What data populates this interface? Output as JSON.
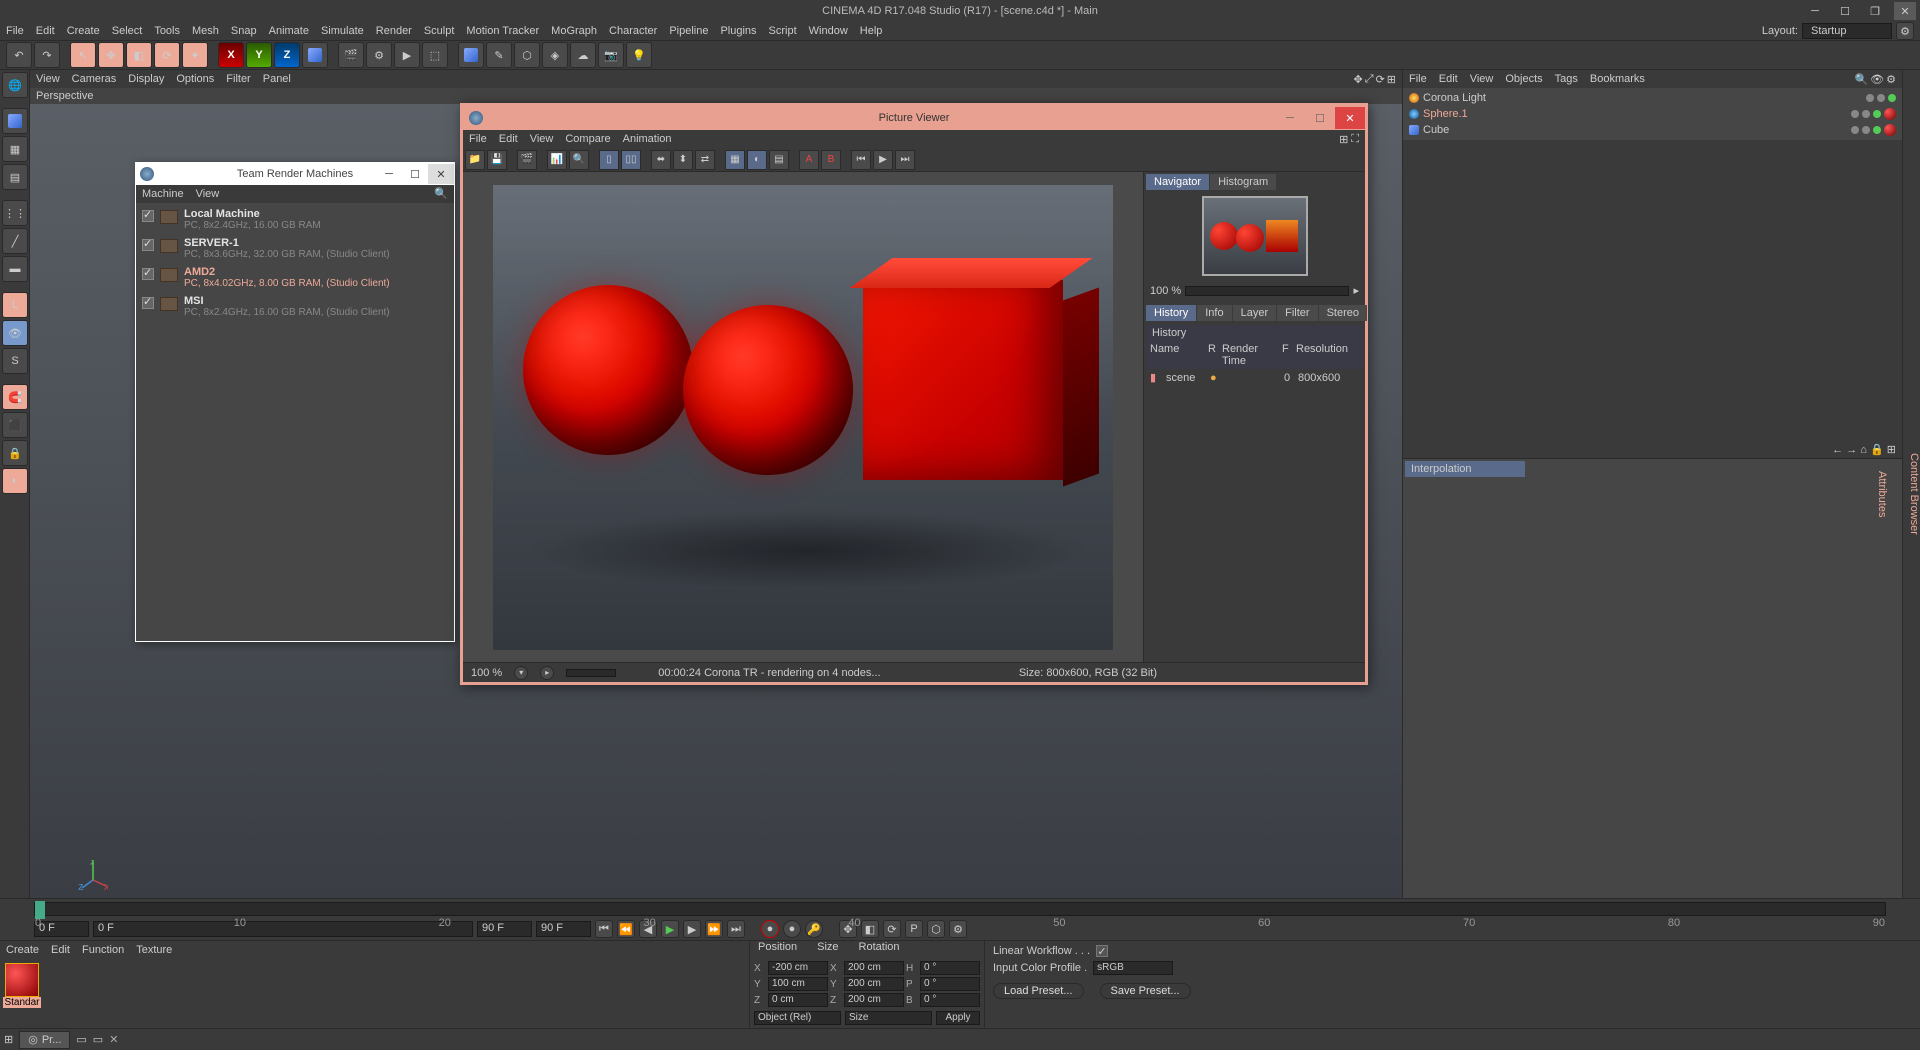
{
  "window": {
    "title": "CINEMA 4D R17.048 Studio (R17) - [scene.c4d *] - Main",
    "layout_label": "Layout:",
    "layout_value": "Startup"
  },
  "menubar": [
    "File",
    "Edit",
    "Create",
    "Select",
    "Tools",
    "Mesh",
    "Snap",
    "Animate",
    "Simulate",
    "Render",
    "Sculpt",
    "Motion Tracker",
    "MoGraph",
    "Character",
    "Pipeline",
    "Plugins",
    "Script",
    "Window",
    "Help"
  ],
  "viewport": {
    "menus": [
      "View",
      "Cameras",
      "Display",
      "Options",
      "Filter",
      "Panel"
    ],
    "label": "Perspective"
  },
  "objects_panel": {
    "menus": [
      "File",
      "Edit",
      "View",
      "Objects",
      "Tags",
      "Bookmarks"
    ],
    "items": [
      {
        "name": "Corona Light",
        "icon": "light",
        "selected": false
      },
      {
        "name": "Sphere.1",
        "icon": "sphere",
        "selected": true
      },
      {
        "name": "Cube",
        "icon": "cube",
        "selected": false
      }
    ]
  },
  "attribute_panel": {
    "tab": "Interpolation"
  },
  "timeline": {
    "start": "0 F",
    "end": "90 F",
    "range_end": "90 F",
    "marks": [
      "0",
      "10",
      "20",
      "30",
      "40",
      "50",
      "60",
      "70",
      "80",
      "90"
    ]
  },
  "material_panel": {
    "menus": [
      "Create",
      "Edit",
      "Function",
      "Texture"
    ],
    "swatch": "Standar"
  },
  "coord_panel": {
    "headers": [
      "Position",
      "Size",
      "Rotation"
    ],
    "rows": [
      {
        "axis": "X",
        "pos": "-200 cm",
        "size_lbl": "X",
        "size": "200 cm",
        "rot_lbl": "H",
        "rot": "0 °"
      },
      {
        "axis": "Y",
        "pos": "100 cm",
        "size_lbl": "Y",
        "size": "200 cm",
        "rot_lbl": "P",
        "rot": "0 °"
      },
      {
        "axis": "Z",
        "pos": "0 cm",
        "size_lbl": "Z",
        "size": "200 cm",
        "rot_lbl": "B",
        "rot": "0 °"
      }
    ],
    "mode1": "Object (Rel)",
    "mode2": "Size",
    "apply": "Apply"
  },
  "props_panel": {
    "linear_workflow": "Linear Workflow . . .",
    "color_profile_lbl": "Input Color Profile .",
    "color_profile_val": "sRGB",
    "load": "Load Preset...",
    "save": "Save Preset..."
  },
  "taskbar": {
    "item": "Pr..."
  },
  "trm": {
    "title": "Team Render Machines",
    "menus": [
      "Machine",
      "View"
    ],
    "rows": [
      {
        "name": "Local Machine",
        "spec": "PC, 8x2.4GHz, 16.00 GB RAM",
        "sel": false
      },
      {
        "name": "SERVER-1",
        "spec": "PC, 8x3.6GHz, 32.00 GB RAM, (Studio Client)",
        "sel": false
      },
      {
        "name": "AMD2",
        "spec": "PC, 8x4.02GHz, 8.00 GB RAM, (Studio Client)",
        "sel": true
      },
      {
        "name": "MSI",
        "spec": "PC, 8x2.4GHz, 16.00 GB RAM, (Studio Client)",
        "sel": false
      }
    ]
  },
  "pv": {
    "title": "Picture Viewer",
    "menus": [
      "File",
      "Edit",
      "View",
      "Compare",
      "Animation"
    ],
    "side_tabs": [
      "Navigator",
      "Histogram"
    ],
    "zoom": "100 %",
    "hist_tabs": [
      "History",
      "Info",
      "Layer",
      "Filter",
      "Stereo"
    ],
    "hist_header": "History",
    "hist_cols": [
      "Name",
      "R",
      "Render Time",
      "F",
      "Resolution"
    ],
    "hist_row": {
      "name": "scene",
      "f": "0",
      "res": "800x600"
    },
    "status": {
      "zoom": "100 %",
      "time": "00:00:24 Corona TR - rendering on 4 nodes...",
      "size": "Size: 800x600, RGB (32 Bit)"
    }
  }
}
